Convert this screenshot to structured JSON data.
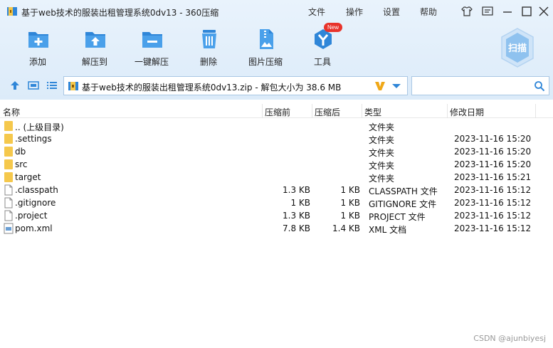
{
  "window": {
    "title": "基于web技术的服装出租管理系统0dv13 - 360压缩",
    "menu": [
      "文件",
      "操作",
      "设置",
      "帮助"
    ]
  },
  "toolbar": {
    "buttons": [
      {
        "label": "添加",
        "icon": "add-icon"
      },
      {
        "label": "解压到",
        "icon": "extract-to-icon"
      },
      {
        "label": "一键解压",
        "icon": "one-click-extract-icon"
      },
      {
        "label": "删除",
        "icon": "delete-icon"
      },
      {
        "label": "图片压缩",
        "icon": "image-compress-icon"
      },
      {
        "label": "工具",
        "icon": "tools-icon"
      }
    ],
    "new_badge": "New",
    "scan_label": "扫描"
  },
  "address": {
    "path": "基于web技术的服装出租管理系统0dv13.zip - 解包大小为 38.6 MB",
    "search_placeholder": ""
  },
  "columns": {
    "name": "名称",
    "size": "压缩前",
    "packed": "压缩后",
    "type": "类型",
    "modified": "修改日期"
  },
  "files": [
    {
      "name": ".. (上级目录)",
      "size": "",
      "packed": "",
      "type": "文件夹",
      "modified": "",
      "kind": "folder"
    },
    {
      "name": ".settings",
      "size": "",
      "packed": "",
      "type": "文件夹",
      "modified": "2023-11-16 15:20",
      "kind": "folder"
    },
    {
      "name": "db",
      "size": "",
      "packed": "",
      "type": "文件夹",
      "modified": "2023-11-16 15:20",
      "kind": "folder"
    },
    {
      "name": "src",
      "size": "",
      "packed": "",
      "type": "文件夹",
      "modified": "2023-11-16 15:20",
      "kind": "folder"
    },
    {
      "name": "target",
      "size": "",
      "packed": "",
      "type": "文件夹",
      "modified": "2023-11-16 15:21",
      "kind": "folder"
    },
    {
      "name": ".classpath",
      "size": "1.3 KB",
      "packed": "1 KB",
      "type": "CLASSPATH 文件",
      "modified": "2023-11-16 15:12",
      "kind": "file"
    },
    {
      "name": ".gitignore",
      "size": "1 KB",
      "packed": "1 KB",
      "type": "GITIGNORE 文件",
      "modified": "2023-11-16 15:12",
      "kind": "file"
    },
    {
      "name": ".project",
      "size": "1.3 KB",
      "packed": "1 KB",
      "type": "PROJECT 文件",
      "modified": "2023-11-16 15:12",
      "kind": "file"
    },
    {
      "name": "pom.xml",
      "size": "7.8 KB",
      "packed": "1.4 KB",
      "type": "XML 文档",
      "modified": "2023-11-16 15:12",
      "kind": "xml"
    }
  ],
  "watermark": "CSDN @ajunbiyesj",
  "colors": {
    "accent": "#2f86d8",
    "folder": "#f5c84c",
    "badge": "#e8332b"
  }
}
